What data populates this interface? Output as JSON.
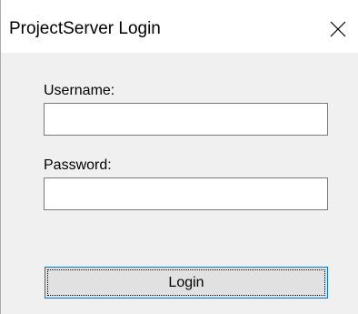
{
  "window": {
    "title": "ProjectServer Login"
  },
  "form": {
    "username_label": "Username:",
    "username_value": "",
    "password_label": "Password:",
    "password_value": "",
    "login_label": "Login"
  },
  "icons": {
    "close": "close-icon"
  },
  "colors": {
    "background": "#f0f0f0",
    "titlebar": "#ffffff",
    "button_face": "#e1e1e1",
    "focus_border": "#0078d7"
  }
}
